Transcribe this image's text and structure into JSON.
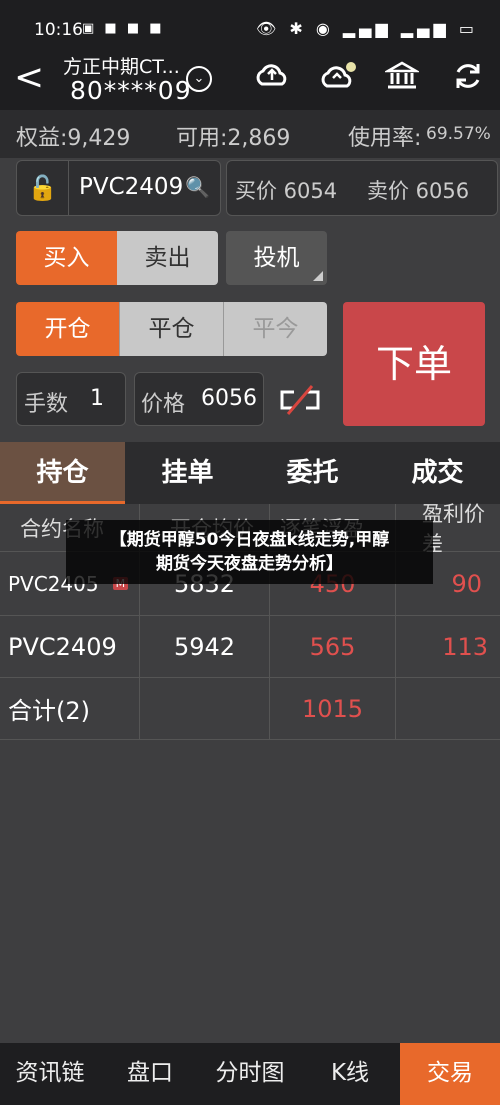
{
  "status": {
    "time": "10:16",
    "left_icons": "▣ ■ ■ ■",
    "right_icons": "👁 ✱ ◉ ▂▄▆ ▂▄▆ ▭"
  },
  "header": {
    "broker": "方正中期CT...",
    "account": "80****09",
    "back_glyph": "<",
    "chev": "⌄"
  },
  "summary": {
    "equity": "权益:9,429",
    "available": "可用:2,869",
    "usage": "使用率:",
    "usage_value": "69.57%"
  },
  "order": {
    "lock_glyph": "🔓",
    "contract": "PVC2409",
    "search_glyph": "🔍",
    "bid": "买价 6054",
    "ask": "卖价 6056",
    "buy": "买入",
    "sell": "卖出",
    "type": "投机",
    "open": "开仓",
    "close": "平仓",
    "close_today": "平今",
    "submit": "下单",
    "qty_label": "手数",
    "qty": "1",
    "price_label": "价格",
    "price": "6056",
    "link_glyph": "⊏⊐"
  },
  "tabs": [
    "持仓",
    "挂单",
    "委托",
    "成交"
  ],
  "table": {
    "headers": [
      "合约名称",
      "开仓均价",
      "逐笔浮盈",
      "盈利价差"
    ],
    "rows": [
      {
        "name": "PVC2405",
        "badge": "M",
        "avg": "5832",
        "pnl": "450",
        "spread": "90"
      },
      {
        "name": "PVC2409",
        "badge": "",
        "avg": "5942",
        "pnl": "565",
        "spread": "113"
      },
      {
        "name": "合计(2)",
        "badge": "",
        "avg": "",
        "pnl": "1015",
        "spread": ""
      }
    ]
  },
  "overlay": {
    "line1": "【期货甲醇50今日夜盘k线走势,甲醇",
    "line2": "期货今天夜盘走势分析】"
  },
  "bottom_nav": [
    "资讯链",
    "盘口",
    "分时图",
    "K线",
    "交易"
  ]
}
